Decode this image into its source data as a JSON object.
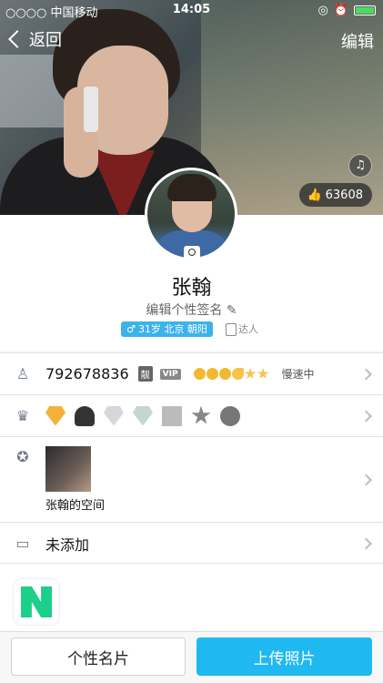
{
  "status_bar": {
    "carrier": "○○○○ 中国移动",
    "time": "14:05",
    "battery_color": "#4cd964"
  },
  "nav": {
    "back_label": "返回",
    "edit_label": "编辑"
  },
  "cover": {
    "music_icon": "music-note-icon",
    "likes": "63608"
  },
  "profile": {
    "name": "张翰",
    "signature": "编辑个性签名",
    "tag": "31岁 北京 朝阳",
    "badge": "达人"
  },
  "rows": {
    "qq_number": "792678836",
    "pretty_badge": "靓",
    "vip": "VIP",
    "speed": "慢速中",
    "space_label": "张翰的空间",
    "address": "未添加"
  },
  "bottom": {
    "card_button": "个性名片",
    "upload_button": "上传照片"
  },
  "colors": {
    "accent": "#1fb8f1",
    "tag": "#3bb3ea",
    "app_icon": "#1ccf8a"
  }
}
